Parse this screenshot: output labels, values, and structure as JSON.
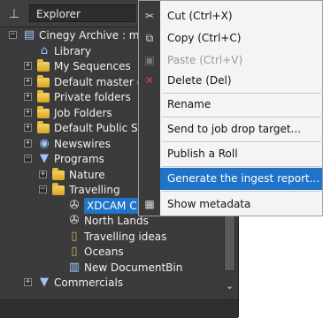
{
  "explorer": {
    "title": "Explorer",
    "tree": [
      {
        "label": "Cinegy Archive : mas",
        "level": 0,
        "expander": "−",
        "icon": "database-icon"
      },
      {
        "label": "Library",
        "level": 1,
        "expander": "",
        "icon": "library-icon"
      },
      {
        "label": "My Sequences",
        "level": 1,
        "expander": "+",
        "icon": "folder-icon"
      },
      {
        "label": "Default master cl",
        "level": 1,
        "expander": "+",
        "icon": "folder-icon"
      },
      {
        "label": "Private folders",
        "level": 1,
        "expander": "+",
        "icon": "folder-icon"
      },
      {
        "label": "Job Folders",
        "level": 1,
        "expander": "+",
        "icon": "folder-icon"
      },
      {
        "label": "Default Public Se",
        "level": 1,
        "expander": "+",
        "icon": "folder-icon"
      },
      {
        "label": "Newswires",
        "level": 1,
        "expander": "+",
        "icon": "newswires-icon"
      },
      {
        "label": "Programs",
        "level": 1,
        "expander": "−",
        "icon": "programs-icon"
      },
      {
        "label": "Nature",
        "level": 2,
        "expander": "+",
        "icon": "folder-icon"
      },
      {
        "label": "Travelling",
        "level": 2,
        "expander": "−",
        "icon": "folder-icon"
      },
      {
        "label": "XDCAM C",
        "level": 3,
        "expander": "",
        "icon": "reel-icon",
        "selected": true
      },
      {
        "label": "North Lands",
        "level": 3,
        "expander": "",
        "icon": "reel-icon"
      },
      {
        "label": "Travelling ideas",
        "level": 3,
        "expander": "",
        "icon": "bin-icon"
      },
      {
        "label": "Oceans",
        "level": 3,
        "expander": "",
        "icon": "bin-icon"
      },
      {
        "label": "New DocumentBin",
        "level": 3,
        "expander": "",
        "icon": "documentbin-icon"
      },
      {
        "label": "Commercials",
        "level": 1,
        "expander": "+",
        "icon": "programs-icon"
      }
    ]
  },
  "context_menu": {
    "items": [
      {
        "label": "Cut (Ctrl+X)",
        "disabled": false,
        "highlighted": false,
        "icon": "scissors-icon"
      },
      {
        "label": "Copy (Ctrl+C)",
        "disabled": false,
        "highlighted": false,
        "icon": "copy-icon"
      },
      {
        "label": "Paste (Ctrl+V)",
        "disabled": true,
        "highlighted": false,
        "icon": "paste-icon"
      },
      {
        "label": "Delete (Del)",
        "disabled": false,
        "highlighted": false,
        "icon": "delete-icon"
      },
      {
        "label": "Rename",
        "disabled": false,
        "highlighted": false,
        "icon": ""
      },
      {
        "label": "Send to job drop target...",
        "disabled": false,
        "highlighted": false,
        "icon": ""
      },
      {
        "label": "Publish a Roll",
        "disabled": false,
        "highlighted": false,
        "icon": ""
      },
      {
        "label": "Generate the ingest report...",
        "disabled": false,
        "highlighted": true,
        "icon": ""
      },
      {
        "label": "Show metadata",
        "disabled": false,
        "highlighted": false,
        "icon": "metadata-icon"
      }
    ]
  },
  "colors": {
    "accent": "#1f73c8",
    "panel": "#3b3b3b",
    "menu_bg": "#f4f4f4"
  }
}
